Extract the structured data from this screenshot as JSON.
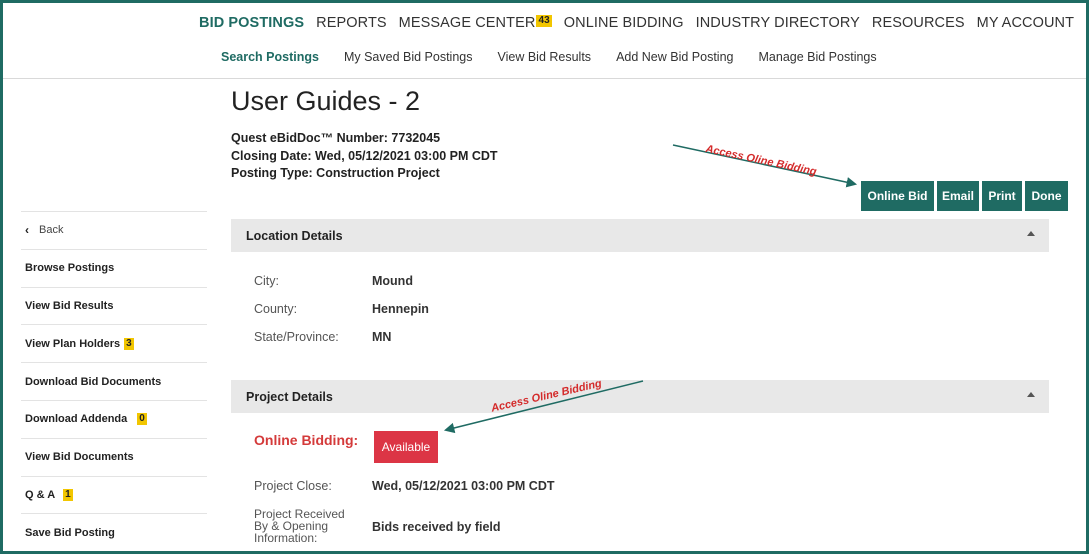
{
  "mainnav": {
    "items": [
      "BID POSTINGS",
      "REPORTS",
      "MESSAGE CENTER",
      "ONLINE BIDDING",
      "INDUSTRY DIRECTORY",
      "RESOURCES",
      "MY ACCOUNT"
    ],
    "message_badge": "43"
  },
  "subnav": {
    "items": [
      "Search Postings",
      "My Saved Bid Postings",
      "View Bid Results",
      "Add New Bid Posting",
      "Manage Bid Postings"
    ]
  },
  "page": {
    "title": "User Guides - 2",
    "ebiddoc": "Quest eBidDoc™ Number: 7732045",
    "closing": "Closing Date: Wed, 05/12/2021 03:00 PM CDT",
    "posting_type": "Posting Type: Construction Project"
  },
  "sidebar": {
    "back": "Back",
    "items": [
      {
        "label": "Browse Postings",
        "badge": ""
      },
      {
        "label": "View Bid Results",
        "badge": ""
      },
      {
        "label": "View Plan Holders",
        "badge": "3"
      },
      {
        "label": "Download Bid Documents",
        "badge": ""
      },
      {
        "label": "Download Addenda",
        "badge": "0"
      },
      {
        "label": "View Bid Documents",
        "badge": ""
      },
      {
        "label": "Q & A",
        "badge": "1"
      },
      {
        "label": "Save Bid Posting",
        "badge": ""
      }
    ]
  },
  "actions": {
    "online_bid": "Online Bid",
    "email": "Email",
    "print": "Print",
    "done": "Done"
  },
  "location": {
    "header": "Location Details",
    "city_label": "City:",
    "city": "Mound",
    "county_label": "County:",
    "county": "Hennepin",
    "state_label": "State/Province:",
    "state": "MN"
  },
  "project": {
    "header": "Project Details",
    "online_label": "Online Bidding:",
    "online_status": "Available",
    "close_label": "Project Close:",
    "close_value": "Wed, 05/12/2021 03:00 PM CDT",
    "received_label": "Project Received By & Opening Information:",
    "received_value": "Bids received by field"
  },
  "annotations": {
    "top": "Access Oline Bidding",
    "bottom": "Access Oline Bidding"
  },
  "colors": {
    "brand": "#1f6b63",
    "badge": "#f2c600",
    "alert": "#dc3545",
    "annotation": "#d42b2b"
  }
}
